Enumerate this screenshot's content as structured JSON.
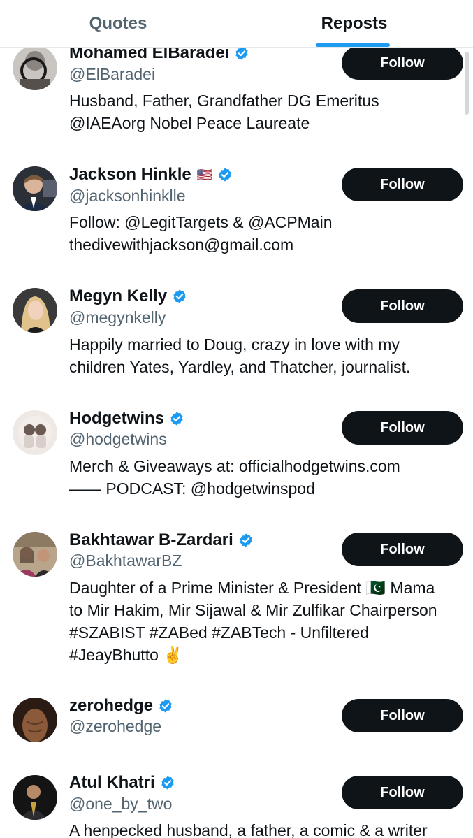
{
  "tabs": {
    "quotes": "Quotes",
    "reposts": "Reposts",
    "active": "reposts"
  },
  "colors": {
    "accent": "#1d9bf0",
    "verified": "#1d9bf0",
    "button_bg": "#0f1419",
    "secondary_text": "#536471"
  },
  "users": [
    {
      "name": "Mohamed ElBaradei",
      "handle": "@ElBaradei",
      "bio_lines": [
        "Husband, Father, Grandfather DG Emeritus",
        "@IAEAorg Nobel Peace Laureate"
      ],
      "flag": "",
      "verified": true,
      "follow_label": "Follow"
    },
    {
      "name": "Jackson Hinkle",
      "handle": "@jacksonhinklle",
      "bio_lines": [
        "Follow: @LegitTargets & @ACPMain",
        "thedivewithjackson@gmail.com"
      ],
      "flag": "🇺🇸",
      "verified": true,
      "follow_label": "Follow"
    },
    {
      "name": "Megyn Kelly",
      "handle": "@megynkelly",
      "bio_lines": [
        "Happily married to Doug, crazy in love with my",
        "children Yates, Yardley, and Thatcher, journalist."
      ],
      "flag": "",
      "verified": true,
      "follow_label": "Follow"
    },
    {
      "name": "Hodgetwins",
      "handle": "@hodgetwins",
      "bio_lines": [
        "Merch & Giveaways at: officialhodgetwins.com",
        "—— PODCAST: @hodgetwinspod"
      ],
      "flag": "",
      "verified": true,
      "follow_label": "Follow"
    },
    {
      "name": "Bakhtawar B-Zardari",
      "handle": "@BakhtawarBZ",
      "bio_lines": [
        "Daughter of a Prime Minister & President 🇵🇰 Mama",
        "to Mir Hakim, Mir Sijawal & Mir Zulfikar Chairperson",
        "#SZABIST #ZABed #ZABTech - Unfiltered",
        "#JeayBhutto ✌️"
      ],
      "flag": "",
      "verified": true,
      "follow_label": "Follow"
    },
    {
      "name": "zerohedge",
      "handle": "@zerohedge",
      "bio_lines": [],
      "flag": "",
      "verified": true,
      "follow_label": "Follow"
    },
    {
      "name": "Atul Khatri",
      "handle": "@one_by_two",
      "bio_lines": [
        "A henpecked husband, a father, a comic & a writer"
      ],
      "flag": "",
      "verified": true,
      "follow_label": "Follow"
    }
  ]
}
